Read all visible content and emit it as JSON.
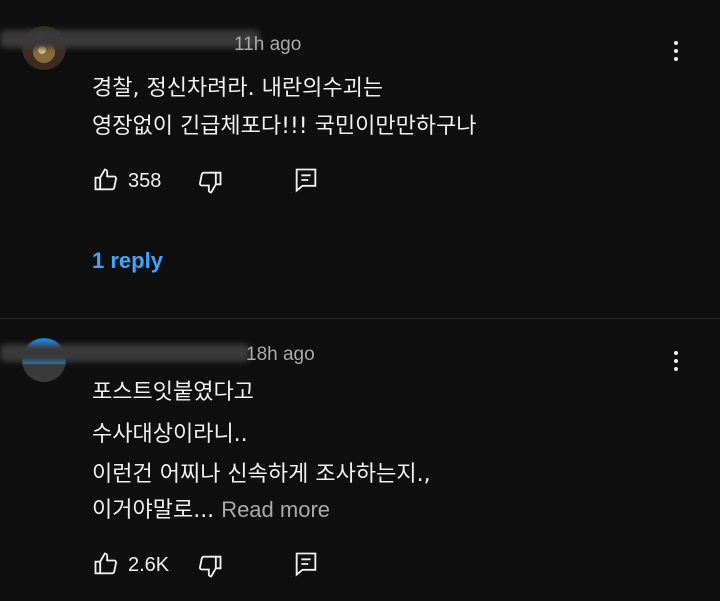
{
  "comments": [
    {
      "time": "11h ago",
      "lines": [
        "경찰, 정신차려라. 내란의수괴는",
        "영장없이 긴급체포다!!! 국민이만만하구나"
      ],
      "likes": "358",
      "reply_label": "1 reply"
    },
    {
      "time": "18h ago",
      "lines": [
        "포스트잇붙였다고",
        "수사대상이라니..",
        "이런건 어찌나 신속하게 조사하는지.,",
        "이거야말로..."
      ],
      "read_more": "Read more",
      "likes": "2.6K"
    }
  ],
  "colors": {
    "background": "#0f0f0f",
    "text": "#f1f1f1",
    "secondary": "#aaaaaa",
    "link": "#3ea6ff"
  },
  "icons": [
    "more-vert-icon",
    "thumbs-up-icon",
    "thumbs-down-icon",
    "reply-comment-icon"
  ]
}
